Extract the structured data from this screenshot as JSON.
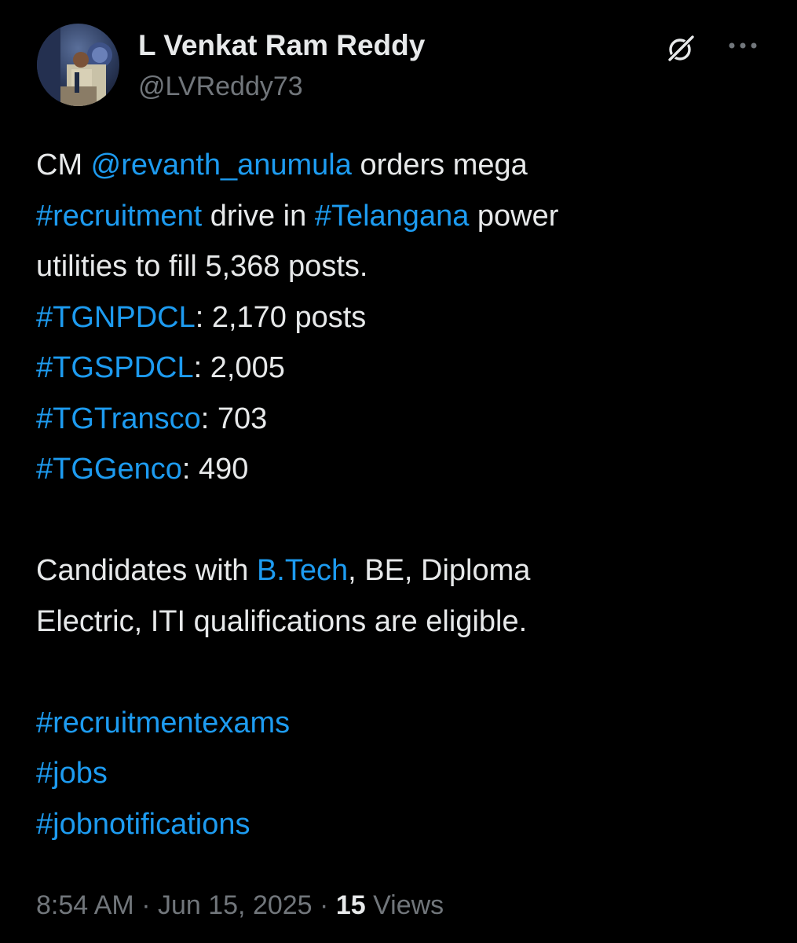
{
  "author": {
    "display_name": "L Venkat Ram Reddy",
    "handle": "@LVReddy73",
    "avatar_icon": "profile-photo"
  },
  "header_icons": {
    "grok": "grok-icon",
    "more": "more-options-icon"
  },
  "colors": {
    "background": "#000000",
    "text": "#e7e9ea",
    "secondary": "#71767b",
    "link": "#1d9bf0"
  },
  "tweet": {
    "l1_a": "CM ",
    "l1_mention": "@revanth_anumula",
    "l1_b": " orders mega",
    "l2_tag": "#recruitment",
    "l2_a": " drive in ",
    "l2_tag2": "#Telangana",
    "l2_b": " power",
    "l3": "utilities to fill 5,368 posts.",
    "l4_tag": "#TGNPDCL",
    "l4_val": ": 2,170 posts",
    "l5_tag": "#TGSPDCL",
    "l5_val": ": 2,005",
    "l6_tag": "#TGTransco",
    "l6_val": ": 703",
    "l7_tag": "#TGGenco",
    "l7_val": ": 490",
    "l9_a": "Candidates with ",
    "l9_link": "B.Tech",
    "l9_b": ", BE, Diploma",
    "l10": "Electric, ITI qualifications are eligible.",
    "l12_tag": "#recruitmentexams",
    "l13_tag": "#jobs",
    "l14_tag": "#jobnotifications"
  },
  "meta": {
    "time": "8:54 AM",
    "sep1": " · ",
    "date": "Jun 15, 2025",
    "sep2": " · ",
    "views_count": "15",
    "views_label": " Views"
  }
}
